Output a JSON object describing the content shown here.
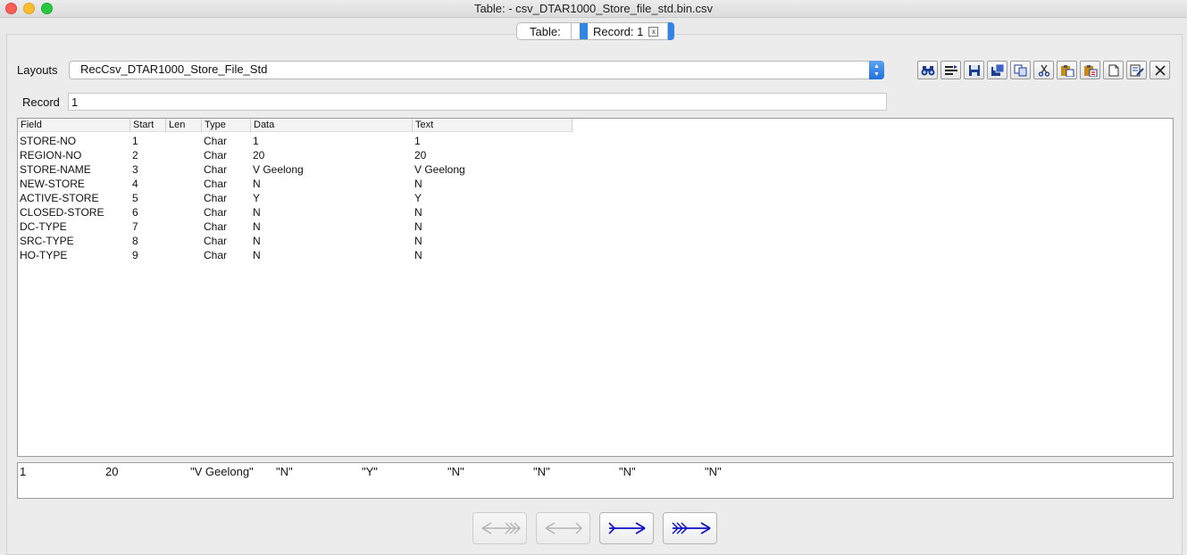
{
  "window": {
    "title": "Table: - csv_DTAR1000_Store_file_std.bin.csv"
  },
  "tabs": [
    {
      "label": "Table:"
    },
    {
      "label": "Record: 1",
      "close": "x"
    }
  ],
  "layouts": {
    "label": "Layouts",
    "selected": "RecCsv_DTAR1000_Store_File_Std"
  },
  "toolbar": {
    "icons": [
      "binoculars-icon",
      "fields-icon",
      "save-icon",
      "save-as-icon",
      "copy-icon",
      "cut-icon",
      "paste-icon",
      "paste-prior-icon",
      "new-icon",
      "edit-icon",
      "close-icon"
    ]
  },
  "record": {
    "label": "Record",
    "value": "1"
  },
  "grid": {
    "columns": [
      "Field",
      "Start",
      "Len",
      "Type",
      "Data",
      "Text"
    ],
    "rows": [
      {
        "field": "STORE-NO",
        "start": "1",
        "len": "",
        "type": "Char",
        "data": "1",
        "text": "1"
      },
      {
        "field": "REGION-NO",
        "start": "2",
        "len": "",
        "type": "Char",
        "data": "20",
        "text": "20"
      },
      {
        "field": "STORE-NAME",
        "start": "3",
        "len": "",
        "type": "Char",
        "data": "V Geelong",
        "text": "V Geelong"
      },
      {
        "field": "NEW-STORE",
        "start": "4",
        "len": "",
        "type": "Char",
        "data": "N",
        "text": "N"
      },
      {
        "field": "ACTIVE-STORE",
        "start": "5",
        "len": "",
        "type": "Char",
        "data": "Y",
        "text": "Y"
      },
      {
        "field": "CLOSED-STORE",
        "start": "6",
        "len": "",
        "type": "Char",
        "data": "N",
        "text": "N"
      },
      {
        "field": "DC-TYPE",
        "start": "7",
        "len": "",
        "type": "Char",
        "data": "N",
        "text": "N"
      },
      {
        "field": "SRC-TYPE",
        "start": "8",
        "len": "",
        "type": "Char",
        "data": "N",
        "text": "N"
      },
      {
        "field": "HO-TYPE",
        "start": "9",
        "len": "",
        "type": "Char",
        "data": "N",
        "text": "N"
      }
    ]
  },
  "raw_line": [
    "1",
    "20",
    "\"V Geelong\"",
    "\"N\"",
    "\"Y\"",
    "\"N\"",
    "\"N\"",
    "\"N\"",
    "\"N\""
  ],
  "navigation": {
    "buttons": [
      {
        "name": "first-record-button",
        "enabled": false
      },
      {
        "name": "previous-record-button",
        "enabled": false
      },
      {
        "name": "next-record-button",
        "enabled": true
      },
      {
        "name": "last-record-button",
        "enabled": true
      }
    ]
  }
}
